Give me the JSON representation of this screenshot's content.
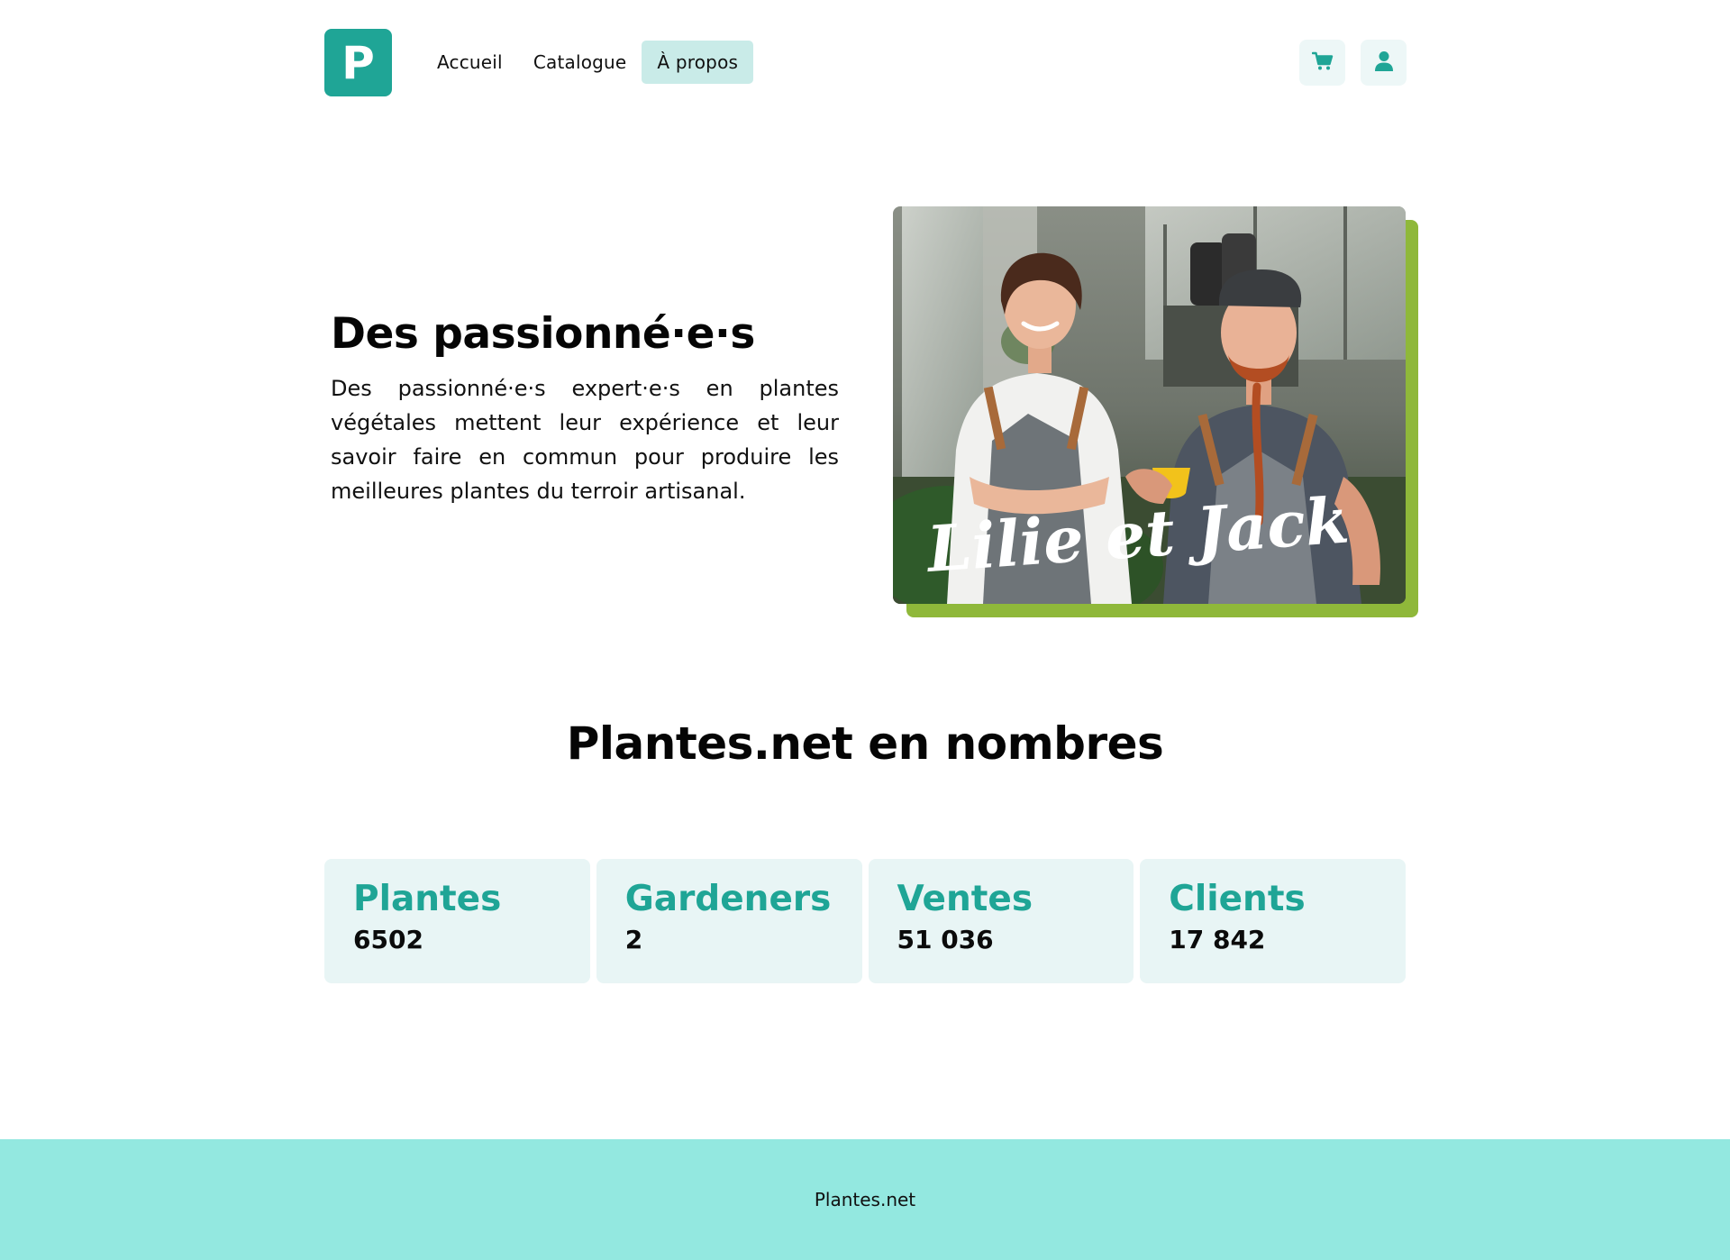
{
  "header": {
    "logo_letter": "P",
    "nav": [
      {
        "label": "Accueil",
        "active": false
      },
      {
        "label": "Catalogue",
        "active": false
      },
      {
        "label": "À propos",
        "active": true
      }
    ],
    "cart_icon": "shopping-cart-icon",
    "user_icon": "user-icon"
  },
  "hero": {
    "title": "Des passionné·e·s",
    "text": "Des passionné·e·s expert·e·s en plantes végétales mettent leur expérience et leur savoir faire en commun pour produire les meilleures plantes du terroir artisanal.",
    "photo_caption": "Lilie et Jack"
  },
  "stats": {
    "title": "Plantes.net en nombres",
    "items": [
      {
        "label": "Plantes",
        "value": "6502"
      },
      {
        "label": "Gardeners",
        "value": "2"
      },
      {
        "label": "Ventes",
        "value": "51 036"
      },
      {
        "label": "Clients",
        "value": "17 842"
      }
    ]
  },
  "footer": {
    "text": "Plantes.net"
  },
  "colors": {
    "brand": "#1fa596",
    "nav_active_bg": "#c9ebe8",
    "card_bg": "#e8f5f5",
    "photo_accent": "#8fb83a",
    "footer_bg": "#93e8e0"
  }
}
